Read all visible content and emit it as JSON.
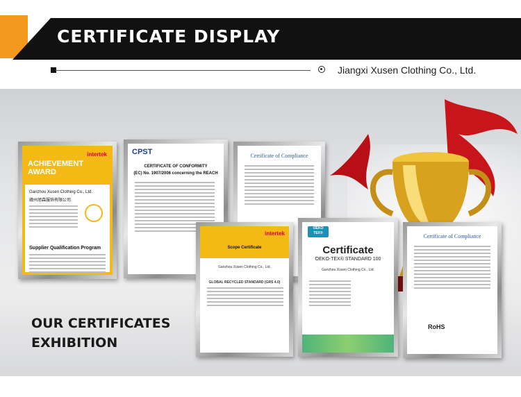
{
  "header": {
    "title": "CERTIFICATE DISPLAY",
    "company": "Jiangxi Xusen Clothing Co., Ltd."
  },
  "exhibition": {
    "line1": "OUR CERTIFICATES",
    "line2": "EXHIBITION"
  },
  "certificates": {
    "achievement": {
      "line1": "ACHIEVEMENT",
      "line2": "AWARD",
      "logo": "intertek",
      "company_en": "Ganzhou Xusen Clothing Co., Ltd.",
      "company_cn": "赣州旭森服饰有限公司",
      "program": "Supplier Qualification Program"
    },
    "cpst": {
      "logo": "CPST",
      "title": "CERTIFICATE OF CONFORMITY",
      "subtitle": "(EC) No. 1907/2006 concerning the REACH"
    },
    "compliance1": {
      "title": "Certificate of Compliance"
    },
    "scope": {
      "logo": "intertek",
      "title": "Scope Certificate",
      "company": "Ganzhou Xusen Clothing Co., Ltd.",
      "standard": "GLOBAL RECYCLED STANDARD (GRS 4.0)"
    },
    "oeko": {
      "badge_line1": "OEKO",
      "badge_line2": "TEX®",
      "title": "Certificate",
      "standard": "OEKO-TEX® STANDARD 100",
      "company": "Ganzhou Xusen Clothing Co., Ltd."
    },
    "compliance2": {
      "title": "Certificate of Compliance",
      "rohs": "RoHS"
    }
  },
  "colors": {
    "accent_orange": "#f39a1e",
    "banner_black": "#111111",
    "intertek_yellow": "#f5b915",
    "compliance_blue": "#2c5fa5"
  }
}
